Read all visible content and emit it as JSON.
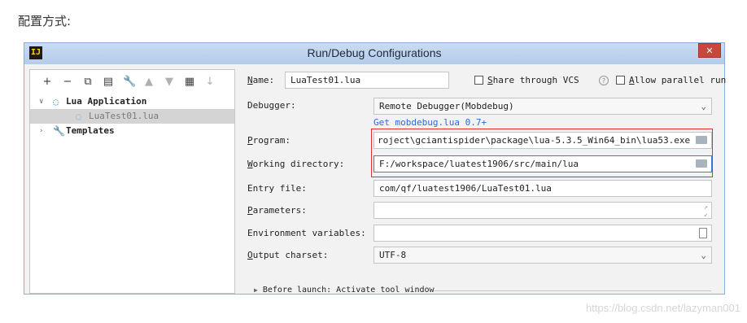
{
  "page": {
    "heading": "配置方式:",
    "watermark": "https://blog.csdn.net/lazyman001"
  },
  "dialog": {
    "title": "Run/Debug Configurations",
    "logo": "IJ",
    "close_glyph": "✕"
  },
  "toolbar": [
    {
      "icon": "+",
      "name": "add-icon",
      "dim": false
    },
    {
      "icon": "−",
      "name": "remove-icon",
      "dim": false
    },
    {
      "icon": "⧉",
      "name": "copy-icon",
      "dim": false
    },
    {
      "icon": "▤",
      "name": "save-icon",
      "dim": false
    },
    {
      "icon": "🔧",
      "name": "wrench-icon",
      "dim": false
    },
    {
      "icon": "▲",
      "name": "move-up-icon",
      "dim": true
    },
    {
      "icon": "▼",
      "name": "move-down-icon",
      "dim": true
    },
    {
      "icon": "▦",
      "name": "folder-icon",
      "dim": false
    },
    {
      "icon": "↓",
      "name": "sort-icon",
      "dim": true
    }
  ],
  "tree": {
    "group": "Lua Application",
    "child": "LuaTest01.lua",
    "templates": "Templates"
  },
  "form": {
    "name_label": "Name:",
    "name_value": "LuaTest01.lua",
    "share_label": "Share through VCS",
    "help_glyph": "?",
    "parallel_label": "Allow parallel run",
    "debugger_label": "Debugger:",
    "debugger_value": "Remote Debugger(Mobdebug)",
    "get_link": "Get mobdebug.lua 0.7+",
    "program_label": "Program:",
    "program_value": "roject\\gciantispider\\package\\lua-5.3.5_Win64_bin\\lua53.exe",
    "workdir_label": "Working directory:",
    "workdir_value": "F:/workspace/luatest1906/src/main/lua",
    "entry_label": "Entry file:",
    "entry_value": "com/qf/luatest1906/LuaTest01.lua",
    "params_label": "Parameters:",
    "params_value": "",
    "env_label": "Environment variables:",
    "env_value": "",
    "charset_label": "Output charset:",
    "charset_value": "UTF-8",
    "before_launch": "Before launch: Activate tool window"
  }
}
